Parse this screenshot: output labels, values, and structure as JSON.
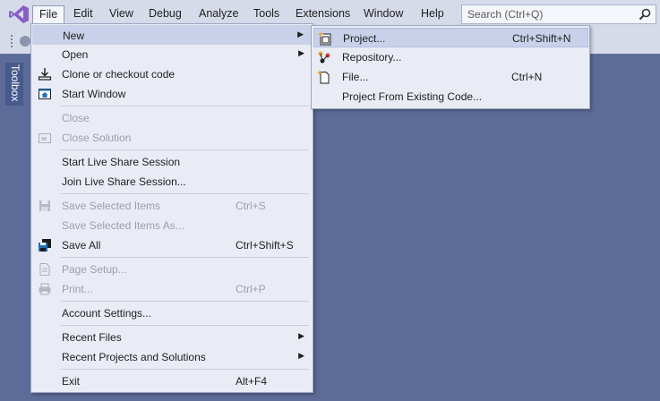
{
  "menubar": {
    "items": [
      "File",
      "Edit",
      "View",
      "Debug",
      "Analyze",
      "Tools",
      "Extensions",
      "Window",
      "Help"
    ],
    "search_placeholder": "Search (Ctrl+Q)"
  },
  "toolbox": {
    "label": "Toolbox"
  },
  "file_menu": {
    "new": "New",
    "open": "Open",
    "clone": "Clone or checkout code",
    "start_window": "Start Window",
    "close": "Close",
    "close_solution": "Close Solution",
    "start_live_share": "Start Live Share Session",
    "join_live_share": "Join Live Share Session...",
    "save_selected": "Save Selected Items",
    "save_selected_shortcut": "Ctrl+S",
    "save_selected_as": "Save Selected Items As...",
    "save_all": "Save All",
    "save_all_shortcut": "Ctrl+Shift+S",
    "page_setup": "Page Setup...",
    "print": "Print...",
    "print_shortcut": "Ctrl+P",
    "account_settings": "Account Settings...",
    "recent_files": "Recent Files",
    "recent_projects": "Recent Projects and Solutions",
    "exit": "Exit",
    "exit_shortcut": "Alt+F4"
  },
  "new_submenu": {
    "project": "Project...",
    "project_shortcut": "Ctrl+Shift+N",
    "repository": "Repository...",
    "file": "File...",
    "file_shortcut": "Ctrl+N",
    "from_existing": "Project From Existing Code..."
  },
  "colors": {
    "background": "#5d6b99",
    "menubar": "#d6dbe9",
    "menu_bg": "#eaecf5",
    "highlight": "#c9d1ea",
    "vs_purple": "#865fc5"
  },
  "icons": {
    "logo": "visual-studio-logo",
    "search": "search-icon",
    "clone": "download-icon",
    "start_window": "home-window-icon",
    "close_solution": "solution-icon",
    "save": "floppy-icon",
    "save_all": "floppy-stack-icon",
    "page_setup": "page-icon",
    "print": "printer-icon",
    "project": "new-project-icon",
    "repository": "repository-icon",
    "file": "new-file-icon"
  }
}
